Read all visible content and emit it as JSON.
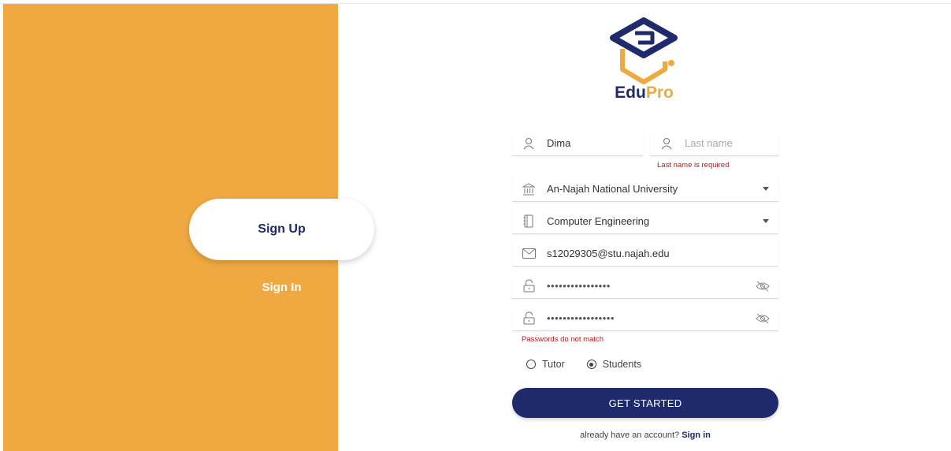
{
  "brand": {
    "edu": "Edu",
    "pro": "Pro"
  },
  "colors": {
    "accent": "#f0a940",
    "primary": "#1e2a6b",
    "error": "#c0141a"
  },
  "side_nav": {
    "signup_label": "Sign Up",
    "signin_label": "Sign In"
  },
  "form": {
    "first_name": {
      "value": "Dima",
      "icon": "person-icon"
    },
    "last_name": {
      "placeholder": "Last name",
      "error": "Last name is required",
      "icon": "person-icon"
    },
    "university": {
      "value": "An-Najah National University",
      "icon": "bank-icon"
    },
    "department": {
      "value": "Computer Engineering",
      "icon": "notebook-icon"
    },
    "email": {
      "value": "s12029305@stu.najah.edu",
      "icon": "mail-icon"
    },
    "password": {
      "masked": "••••••••••••••••",
      "icon": "lock-icon"
    },
    "confirm_password": {
      "masked": "•••••••••••••••••",
      "icon": "lock-icon",
      "error": "Passwords do not match"
    },
    "role_options": [
      {
        "label": "Tutor",
        "selected": false
      },
      {
        "label": "Students",
        "selected": true
      }
    ],
    "submit_label": "GET STARTED"
  },
  "footer": {
    "prompt": "already have an account?",
    "link": "Sign in"
  }
}
